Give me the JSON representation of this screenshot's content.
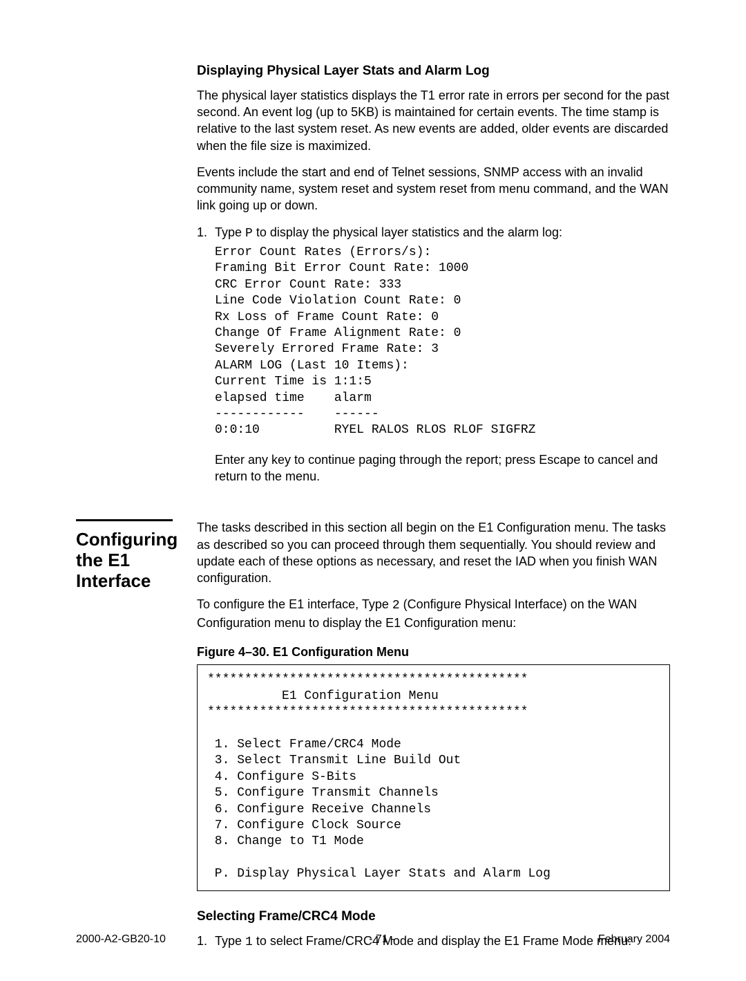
{
  "section1": {
    "heading": "Displaying Physical Layer Stats and Alarm Log",
    "para1": "The physical layer statistics displays the T1 error rate in errors per second for the past second. An event log (up to 5KB) is maintained for certain events. The time stamp is relative to the last system reset. As new events are added, older events are discarded when the file size is maximized.",
    "para2": "Events include the start and end of Telnet sessions, SNMP access with an invalid community name, system reset and system reset from menu command, and the WAN link going up or down.",
    "step_num": "1.",
    "step_pre": "Type ",
    "step_key": "P",
    "step_post": " to display the physical layer statistics and the alarm log:",
    "mono": "Error Count Rates (Errors/s):\nFraming Bit Error Count Rate: 1000\nCRC Error Count Rate: 333\nLine Code Violation Count Rate: 0\nRx Loss of Frame Count Rate: 0\nChange Of Frame Alignment Rate: 0\nSeverely Errored Frame Rate: 3\nALARM LOG (Last 10 Items):\nCurrent Time is 1:1:5\nelapsed time    alarm\n------------    ------\n0:0:10          RYEL RALOS RLOS RLOF SIGFRZ",
    "after": "Enter any key to continue paging through the report; press Escape to cancel and return to the menu."
  },
  "section2": {
    "side_heading": "Configur­ing the E1 Interface",
    "para1": "The tasks described in this section all begin on the E1 Configuration menu. The tasks as described so you can proceed through them sequentially. You should review and update each of these options as necessary, and reset the IAD when you finish WAN configuration.",
    "para2_pre": "To configure the E1 interface, Type ",
    "para2_key": "2",
    "para2_post": " (Configure Physical Interface) on the WAN Configuration menu to display the E1 Configuration menu:",
    "fig_caption": "Figure 4–30.  E1 Configuration Menu",
    "menu": "*******************************************\n          E1 Configuration Menu\n*******************************************\n\n 1. Select Frame/CRC4 Mode\n 3. Select Transmit Line Build Out\n 4. Configure S-Bits\n 5. Configure Transmit Channels\n 6. Configure Receive Channels\n 7. Configure Clock Source\n 8. Change to T1 Mode\n\n P. Display Physical Layer Stats and Alarm Log"
  },
  "section3": {
    "heading": "Selecting Frame/CRC4 Mode",
    "step_num": "1.",
    "step_pre": "Type ",
    "step_key": "1",
    "step_post": " to select Frame/CRC4 Mode and display the E1 Frame Mode menu:"
  },
  "footer": {
    "left": "2000-A2-GB20-10",
    "center": "- 71 -",
    "right": "February 2004"
  }
}
